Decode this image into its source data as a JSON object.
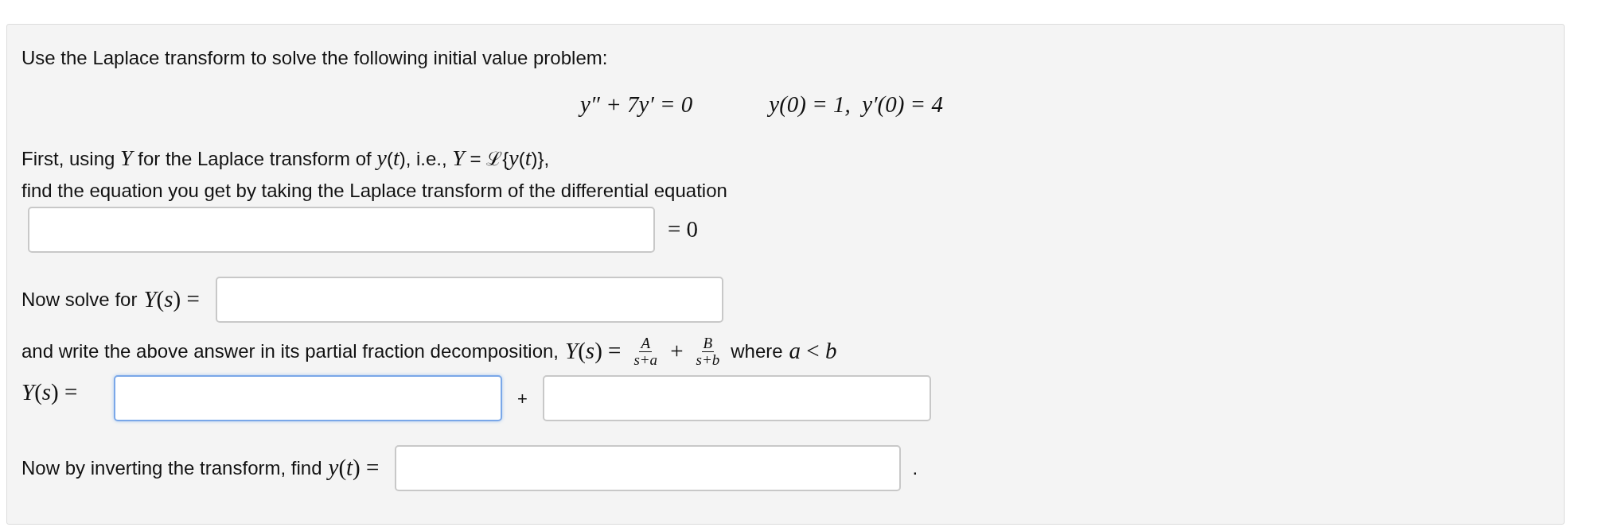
{
  "intro": "Use the Laplace transform to solve the following initial value problem:",
  "equation": {
    "ode": "y″ + 7y′ = 0",
    "conditions": "y(0) = 1,  y′(0) = 4"
  },
  "step_1": {
    "lines": [
      "First, using *Y* for the Laplace transform of *y*(*t*), i.e., *Y* = ℒ{*y*(*t*)},",
      "find the equation you get by taking the Laplace transform of the differential equation"
    ],
    "field": {
      "focused": false
    },
    "suffix": "= 0"
  },
  "step_2": {
    "label": "Now solve for",
    "math": "*Y*(*s*) =",
    "field": {
      "focused": false
    }
  },
  "step_3": {
    "text": "and write the above answer in its partial fraction decomposition,",
    "lhs": "*Y*(*s*) =",
    "fractions": [
      {
        "numerator": "A",
        "denominator": "s+a"
      },
      {
        "numerator": "B",
        "denominator": "s+b"
      }
    ],
    "plus": "+",
    "where": "where",
    "condition": "*a* < *b*"
  },
  "step_4": {
    "math": "*Y*(*s*) =",
    "fields": [
      {
        "focused": true
      },
      {
        "focused": false
      }
    ],
    "plus": "+"
  },
  "step_5": {
    "label": "Now by inverting the transform, find",
    "math": "*y*(*t*) =",
    "field": {
      "focused": false
    },
    "suffix": "."
  }
}
